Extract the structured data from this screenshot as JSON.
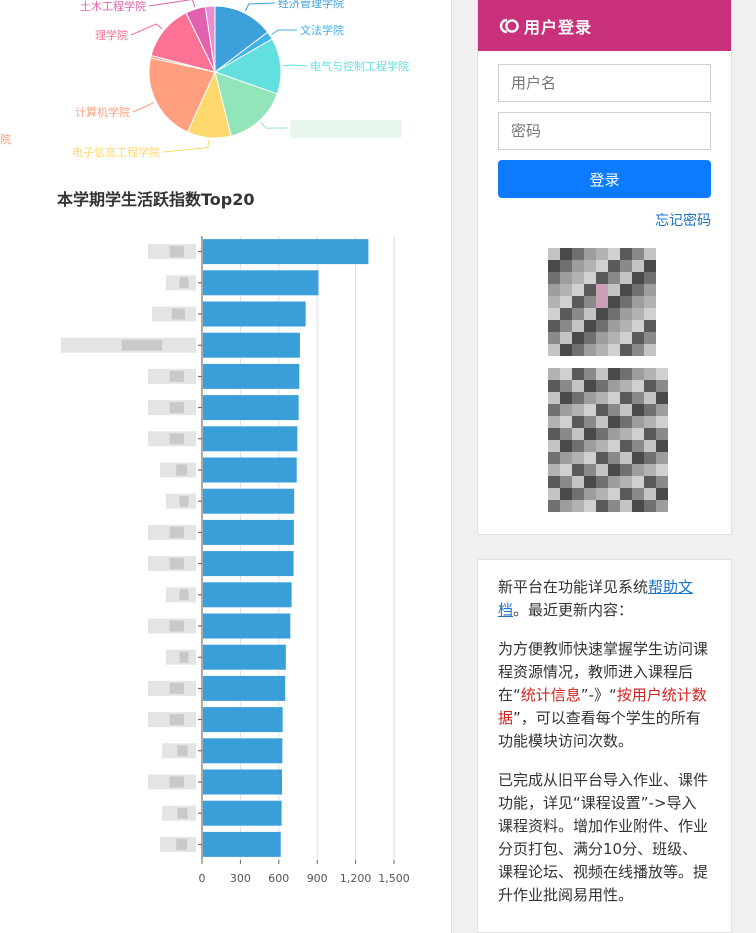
{
  "pie": {
    "slices": [
      {
        "name": "经济管理学院",
        "value": 15,
        "color": "#3ca0db"
      },
      {
        "name": "文法学院",
        "value": 2,
        "color": "#41b4e9"
      },
      {
        "name": "电气与控制工程学院",
        "value": 14,
        "color": "#64dfe0"
      },
      {
        "name": "",
        "value": 16,
        "color": "#92e4b9"
      },
      {
        "name": "电子信息工程学院",
        "value": 11,
        "color": "#ffd86d"
      },
      {
        "name": "计算机学院",
        "value": 22,
        "color": "#ff9f7e"
      },
      {
        "name": "",
        "value": 0.6,
        "color": "#f98c70"
      },
      {
        "name": "理学院",
        "value": 14,
        "color": "#fb7295"
      },
      {
        "name": "土木工程学院",
        "value": 5,
        "color": "#e062ae"
      },
      {
        "name": "",
        "value": 2.4,
        "color": "#e690d1"
      }
    ],
    "cut_label": "院"
  },
  "chart_data": {
    "type": "bar",
    "orientation": "horizontal",
    "title": "本学期学生活跃指数Top20",
    "xlim": [
      0,
      1500
    ],
    "x_ticks": [
      "0",
      "300",
      "600",
      "900",
      "1,200",
      "1,500"
    ],
    "categories": [
      "",
      "",
      "",
      "",
      "",
      "",
      "",
      "",
      "",
      "",
      "",
      "",
      "",
      "",
      "",
      "",
      "",
      "",
      "",
      ""
    ],
    "values": [
      1300,
      910,
      810,
      765,
      760,
      755,
      745,
      740,
      720,
      718,
      715,
      700,
      690,
      655,
      650,
      630,
      628,
      625,
      622,
      615
    ],
    "color": "#3a9fd9",
    "grid": true
  },
  "login": {
    "title": "用户登录",
    "username_placeholder": "用户名",
    "password_placeholder": "密码",
    "submit_label": "登录",
    "forgot_label": "忘记密码"
  },
  "notice": {
    "p1_a": "新平台在功能详见系统",
    "p1_link": "帮助文档",
    "p1_b": "。最近更新内容：",
    "p2_a": "为方便教师快速掌握学生访问课程资源情况，教师进入课程后在“",
    "p2_red1": "统计信息",
    "p2_b": "”-》“",
    "p2_red2": "按用户统计数据",
    "p2_c": "”，可以查看每个学生的所有功能模块访问次数。",
    "p3": "已完成从旧平台导入作业、课件功能，详见“课程设置”->导入课程资料。增加作业附件、作业分页打包、满分10分、班级、课程论坛、视频在线播放等。提升作业批阅易用性。"
  },
  "colors": {
    "brand": "#c9317a",
    "primary": "#0d7bff",
    "bar": "#3a9fd9"
  }
}
